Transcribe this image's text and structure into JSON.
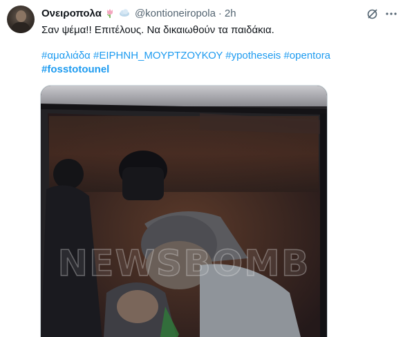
{
  "tweet": {
    "display_name": "Ονειροπολα",
    "handle": "@kontioneiropola",
    "separator": "·",
    "time": "2h",
    "text": "Σαν ψέμα!! Επιτέλους. Να δικαιωθούν τα παιδάκια.",
    "hashtags": [
      "#αμαλιάδα",
      "#ΕΙΡΗΝΗ_ΜΟΥΡΤΖΟΥΚΟΥ",
      "#ypotheseis",
      "#opentora",
      "#fosstotounel"
    ],
    "emojis": [
      "tulip-emoji",
      "cloud-emoji"
    ]
  },
  "media": {
    "watermark": "NEWSBOMB",
    "description_icon": "photo"
  },
  "icons": {
    "grok": "grok-icon",
    "more": "more-icon"
  },
  "colors": {
    "link": "#1d9bf0",
    "secondary_text": "#536471",
    "primary_text": "#0f1419"
  }
}
